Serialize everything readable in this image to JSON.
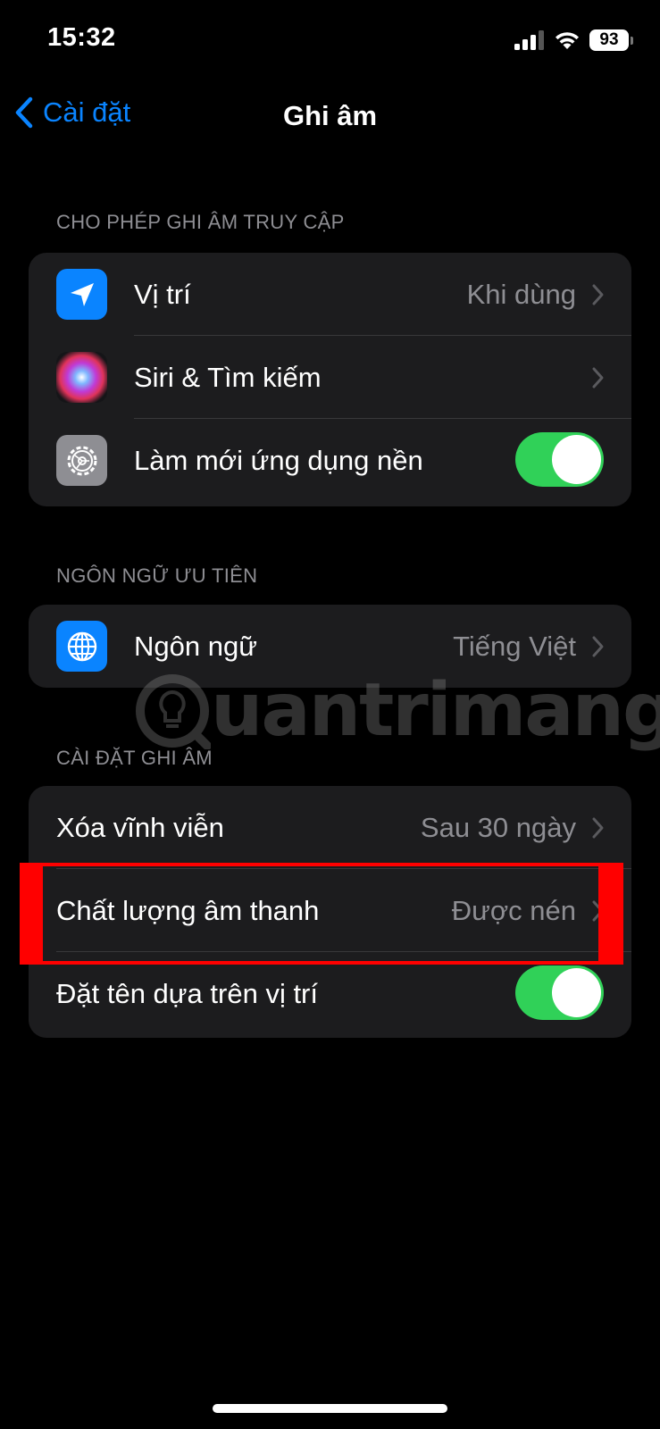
{
  "status_bar": {
    "time": "15:32",
    "battery": "93"
  },
  "nav": {
    "back_label": "Cài đặt",
    "title": "Ghi âm"
  },
  "sections": {
    "access": {
      "header": "CHO PHÉP GHI ÂM TRUY CẬP",
      "location": {
        "label": "Vị trí",
        "value": "Khi dùng",
        "icon": "location-arrow-icon"
      },
      "siri": {
        "label": "Siri & Tìm kiếm",
        "icon": "siri-icon"
      },
      "background_refresh": {
        "label": "Làm mới ứng dụng nền",
        "icon": "gear-icon",
        "enabled": true
      }
    },
    "language": {
      "header": "NGÔN NGỮ ƯU TIÊN",
      "language": {
        "label": "Ngôn ngữ",
        "value": "Tiếng Việt",
        "icon": "globe-icon"
      }
    },
    "recording": {
      "header": "CÀI ĐẶT GHI ÂM",
      "clear_deleted": {
        "label": "Xóa vĩnh viễn",
        "value": "Sau 30 ngày"
      },
      "audio_quality": {
        "label": "Chất lượng âm thanh",
        "value": "Được nén"
      },
      "location_naming": {
        "label": "Đặt tên dựa trên vị trí",
        "enabled": true
      }
    }
  },
  "watermark": {
    "text": "uantrimang"
  },
  "colors": {
    "accent": "#0a84ff",
    "toggle_on": "#30d158",
    "highlight": "#ff0000",
    "group_bg": "#1c1c1e"
  }
}
